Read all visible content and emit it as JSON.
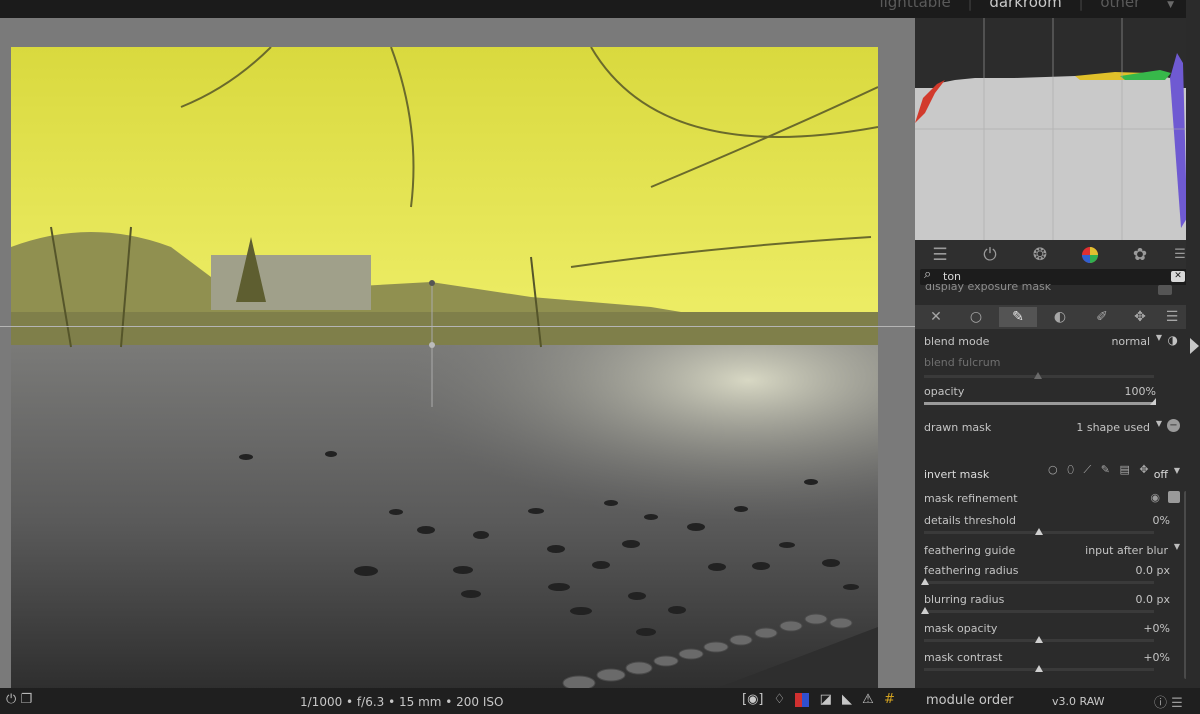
{
  "views": {
    "lighttable": "lighttable",
    "darkroom": "darkroom",
    "other": "other"
  },
  "tabs": [
    "sliders-icon",
    "power-icon",
    "aperture-icon",
    "color-wheel-icon",
    "film-icon",
    "menu-icon"
  ],
  "search": {
    "value": "ton"
  },
  "clipped_row": "display exposure mask",
  "mask_tabs": [
    "off",
    "uniform",
    "drawn",
    "parametric",
    "drawn & parametric",
    "raster"
  ],
  "blend": {
    "blend_mode_label": "blend mode",
    "blend_mode_value": "normal",
    "blend_fulcrum_label": "blend fulcrum",
    "opacity_label": "opacity",
    "opacity_value": "100%",
    "opacity_level": 1.0,
    "drawn_mask_label": "drawn mask",
    "drawn_mask_value": "1 shape used",
    "invert_mask_label": "invert mask",
    "invert_mask_value": "off",
    "mask_refinement_label": "mask refinement",
    "details_threshold_label": "details threshold",
    "details_threshold_value": "0%",
    "details_threshold_level": 0.5,
    "feathering_guide_label": "feathering guide",
    "feathering_guide_value": "input after blur",
    "feathering_radius_label": "feathering radius",
    "feathering_radius_value": "0.0 px",
    "blurring_radius_label": "blurring radius",
    "blurring_radius_value": "0.0 px",
    "mask_opacity_label": "mask opacity",
    "mask_opacity_value": "+0%",
    "mask_opacity_level": 0.5,
    "mask_contrast_label": "mask contrast",
    "mask_contrast_value": "+0%",
    "mask_contrast_level": 0.5
  },
  "bottom": {
    "exif": "1/1000 • f/6.3 • 15 mm • 200 ISO",
    "module_order_label": "module order",
    "module_order_value": "v3.0 RAW"
  },
  "colors": {
    "mask_overlay": "#e6e64a",
    "panel_bg": "#2b2b2b",
    "histogram_bg": "#cbcbcb"
  }
}
